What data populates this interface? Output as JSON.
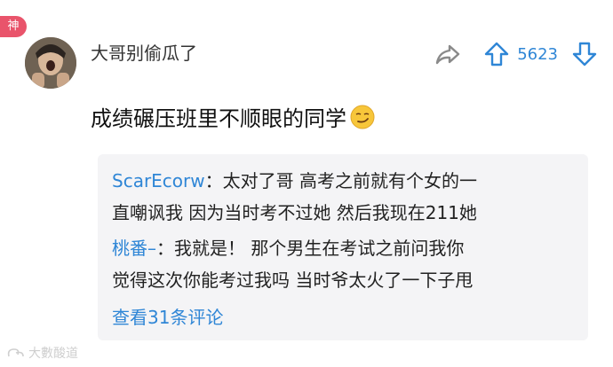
{
  "badge": "神",
  "comment": {
    "username": "大哥别偷瓜了",
    "text": "成绩碾压班里不顺眼的同学",
    "emoji": "smirk-emoji",
    "like_count": "5623"
  },
  "replies": [
    {
      "name": "ScarEcorw",
      "sep": "：",
      "line1": "太对了哥 高考之前就有个女的一",
      "line2": "直嘲讽我 因为当时考不过她 然后我现在211她"
    },
    {
      "name": "桃番–",
      "sep": "：",
      "line1": "我就是！ 那个男生在考试之前问我你",
      "line2": "觉得这次你能考过我吗 当时爷太火了一下子甩"
    }
  ],
  "more_replies": "查看31条评论",
  "watermark": "大數酸道",
  "colors": {
    "accent": "#2f86d6",
    "badge": "#e9546b",
    "reply_bg": "#f4f4f6"
  }
}
